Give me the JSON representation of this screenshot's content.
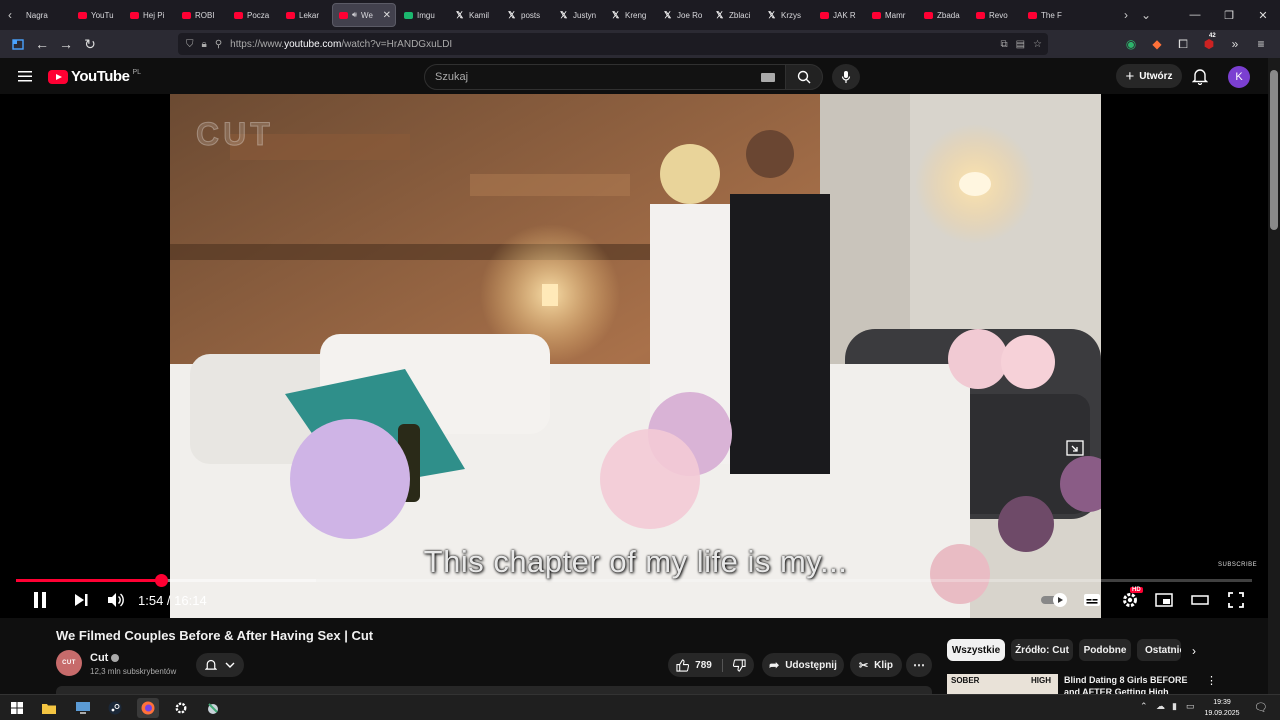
{
  "browser": {
    "tabs": [
      {
        "label": "Nagra",
        "favicon": "text"
      },
      {
        "label": "YouTu",
        "favicon": "youtube-icon"
      },
      {
        "label": "Hej Pi",
        "favicon": "youtube-icon"
      },
      {
        "label": "ROBI",
        "favicon": "youtube-icon"
      },
      {
        "label": "Pocza",
        "favicon": "youtube-icon"
      },
      {
        "label": "Lekar",
        "favicon": "youtube-icon"
      },
      {
        "label": "We",
        "favicon": "youtube-icon",
        "active": true
      },
      {
        "label": "Imgu",
        "favicon": "imgur-icon"
      },
      {
        "label": "Kamil",
        "favicon": "x-icon"
      },
      {
        "label": "posts",
        "favicon": "x-icon"
      },
      {
        "label": "Justyn",
        "favicon": "x-icon"
      },
      {
        "label": "Kreng",
        "favicon": "x-icon"
      },
      {
        "label": "Joe Ro",
        "favicon": "x-icon"
      },
      {
        "label": "Zblaci",
        "favicon": "x-icon"
      },
      {
        "label": "Krzys",
        "favicon": "x-icon"
      },
      {
        "label": "JAK R",
        "favicon": "youtube-icon"
      },
      {
        "label": "Mamr",
        "favicon": "youtube-icon"
      },
      {
        "label": "Zbada",
        "favicon": "youtube-icon"
      },
      {
        "label": "Revo",
        "favicon": "youtube-icon"
      },
      {
        "label": "The F",
        "favicon": "youtube-icon"
      }
    ],
    "url": {
      "prefix": "https://www.",
      "host": "youtube.com",
      "path": "/watch?v=HrANDGxuLDI"
    },
    "extension_badge": "42"
  },
  "youtube": {
    "logo_text": "YouTube",
    "region": "PL",
    "search_placeholder": "Szukaj",
    "create_label": "Utwórz",
    "avatar_letter": "K"
  },
  "player": {
    "caption": "This chapter of my life is my...",
    "watermark": "CUT",
    "subscribe_badge": "SUBSCRIBE",
    "current_time": "1:54",
    "duration": "16:14",
    "time_separator": " / ",
    "progress_played_fraction": 0.117,
    "progress_buffered_fraction": 0.243,
    "quality_badge": "HD"
  },
  "video": {
    "title": "We Filmed Couples Before & After Having Sex | Cut",
    "channel": "Cut",
    "channel_avatar_text": "CUT",
    "subscribers": "12,3 mln subskrybentów",
    "likes": "789",
    "share_label": "Udostępnij",
    "clip_label": "Klip"
  },
  "sidebar": {
    "chips": [
      "Wszystkie",
      "Źródło: Cut",
      "Podobne",
      "Ostatnio"
    ],
    "recommendation": {
      "title": "Blind Dating 8 Girls BEFORE and AFTER Getting High",
      "thumb_left": "SOBER",
      "thumb_right": "HIGH"
    }
  },
  "taskbar": {
    "time": "19:39",
    "date": "19.09.2025"
  },
  "colors": {
    "accent": "#ff0033",
    "background": "#0f0f0f"
  }
}
